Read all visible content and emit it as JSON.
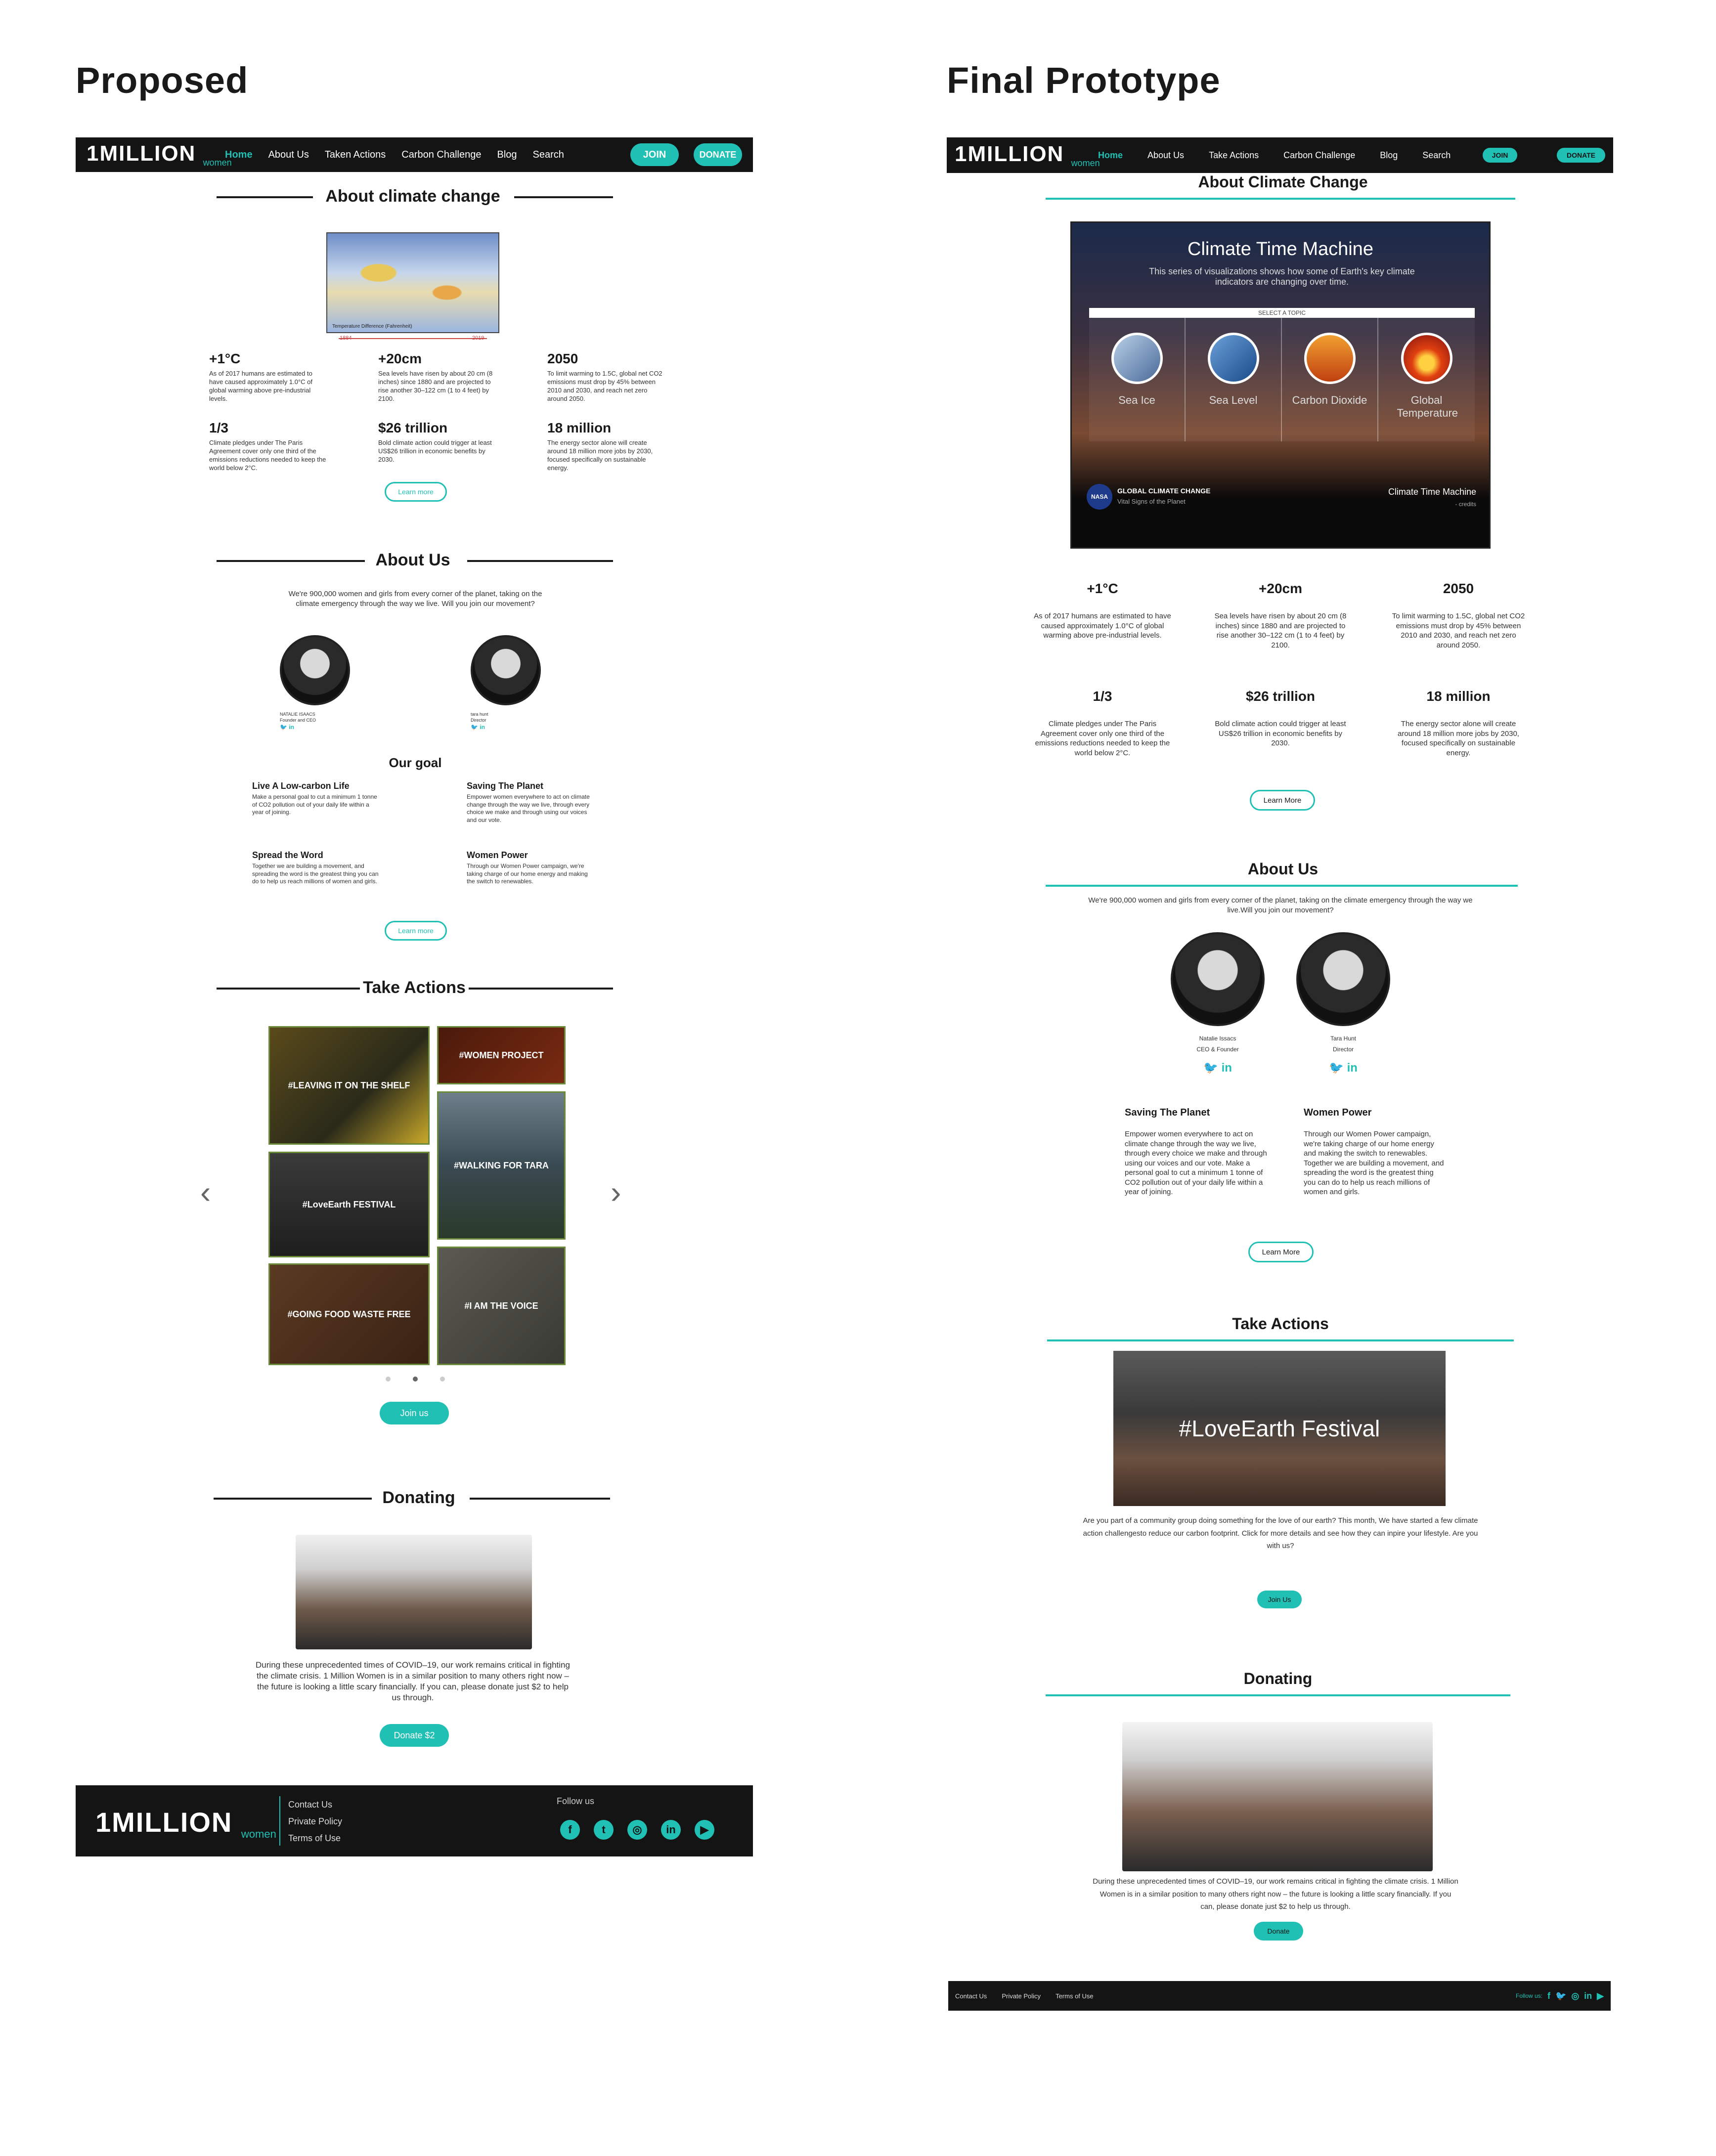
{
  "labels": {
    "proposed": "Proposed",
    "final": "Final Prototype"
  },
  "brand": {
    "logo_main": "1MILLION",
    "logo_sub": "women"
  },
  "nav_proposed": [
    "Home",
    "About Us",
    "Taken Actions",
    "Carbon Challenge",
    "Blog",
    "Search"
  ],
  "nav_final": [
    "Home",
    "About Us",
    "Take Actions",
    "Carbon Challenge",
    "Blog",
    "Search"
  ],
  "buttons": {
    "join_upper": "JOIN",
    "donate_upper": "DONATE",
    "learn_more": "Learn more",
    "learn_more_final": "Learn More",
    "join_us": "Join us",
    "join_us_final": "Join Us",
    "donate2": "Donate $2",
    "donate": "Donate"
  },
  "proposed": {
    "about_climate_title": "About climate change",
    "map_legend": "Temperature Difference (Fahrenheit)",
    "map_years": [
      "1884",
      "2019"
    ],
    "stats": [
      {
        "n": "+1°C",
        "t": "As of 2017 humans are estimated to have caused approximately 1.0°C of global warming above pre-industrial levels."
      },
      {
        "n": "+20cm",
        "t": "Sea levels have risen by about 20 cm (8 inches) since 1880 and are projected to rise another 30–122 cm (1 to 4 feet) by 2100."
      },
      {
        "n": "2050",
        "t": "To limit warming to 1.5C, global net CO2 emissions must drop by 45% between 2010 and 2030, and reach net zero around 2050."
      },
      {
        "n": "1/3",
        "t": "Climate pledges under The Paris Agreement cover only one third of the emissions reductions needed to keep the world below 2°C."
      },
      {
        "n": "$26 trillion",
        "t": "Bold climate action could trigger at least US$26 trillion in economic benefits by 2030."
      },
      {
        "n": "18 million",
        "t": "The energy sector alone will create around 18 million more jobs by 2030, focused specifically on sustainable energy."
      }
    ],
    "about_us_title": "About Us",
    "about_us_text": "We're 900,000 women and girls from every corner of the planet, taking on the climate emergency through the way we live. Will you join our movement?",
    "people": [
      {
        "name": "NATALIE ISAACS",
        "role": "Founder and CEO"
      },
      {
        "name": "tara hunt",
        "role": "Director"
      }
    ],
    "goal_title": "Our goal",
    "goals": [
      {
        "h": "Live A Low-carbon Life",
        "t": "Make a personal goal to cut a minimum 1 tonne of CO2 pollution out of your daily life within a year of joining."
      },
      {
        "h": "Saving The Planet",
        "t": "Empower women everywhere to act on climate change through the way we live, through every choice we make and through using our voices and our vote."
      },
      {
        "h": "Spread the Word",
        "t": "Together we are building a movement, and spreading the word is the greatest thing you can do to help us reach millions of women and girls."
      },
      {
        "h": "Women Power",
        "t": "Through our Women Power campaign, we're taking charge of our home energy and making the switch to renewables."
      }
    ],
    "take_actions_title": "Take Actions",
    "tiles": [
      "#LEAVING IT ON THE SHELF",
      "#WOMEN PROJECT",
      "#WALKING FOR TARA",
      "#LoveEarth FESTIVAL",
      "#GOING FOOD WASTE FREE",
      "#I AM THE VOICE"
    ],
    "donating_title": "Donating",
    "donating_text": "During these unprecedented times of COVID–19, our work remains critical in fighting the climate crisis. 1 Million Women is in a similar position to many others right now – the future is looking a little scary financially. If you can, please donate just $2 to help us through.",
    "footer_links": [
      "Contact Us",
      "Private Policy",
      "Terms of Use"
    ],
    "follow_us": "Follow us"
  },
  "final": {
    "about_climate_title": "About Climate Change",
    "ctm_title": "Climate Time Machine",
    "ctm_sub": "This series of visualizations shows how some of Earth's key climate indicators are changing over time.",
    "ctm_select": "SELECT A TOPIC",
    "ctm_topics": [
      "Sea Ice",
      "Sea Level",
      "Carbon Dioxide",
      "Global Temperature"
    ],
    "ctm_brand": "GLOBAL CLIMATE CHANGE",
    "ctm_brand_sub": "Vital Signs of the Planet",
    "ctm_nasa": "NASA",
    "ctm_credit_title": "Climate Time Machine",
    "ctm_credit": "- credits",
    "stats": [
      {
        "n": "+1°C",
        "t": "As of 2017 humans are estimated to have caused approximately 1.0°C of global warming above pre-industrial levels."
      },
      {
        "n": "+20cm",
        "t": "Sea levels have risen by about 20 cm (8 inches) since 1880 and are projected to rise another 30–122 cm (1 to 4 feet) by 2100."
      },
      {
        "n": "2050",
        "t": "To limit warming to 1.5C, global net CO2 emissions must drop by 45% between 2010 and 2030, and reach net zero around 2050."
      },
      {
        "n": "1/3",
        "t": "Climate pledges under The Paris Agreement cover only one third of the emissions reductions needed to keep the world below 2°C."
      },
      {
        "n": "$26 trillion",
        "t": "Bold climate action could trigger at least US$26 trillion in economic benefits by 2030."
      },
      {
        "n": "18 million",
        "t": "The energy sector alone will create around 18 million more jobs by 2030, focused specifically on sustainable energy."
      }
    ],
    "about_us_title": "About Us",
    "about_us_text": "We're 900,000 women and girls from every corner of the planet, taking on the climate emergency through the way we live.Will you join our movement?",
    "people": [
      {
        "name": "Natalie Issacs",
        "role": "CEO & Founder"
      },
      {
        "name": "Tara Hunt",
        "role": "Director"
      }
    ],
    "goals": [
      {
        "h": "Saving The Planet",
        "t": "Empower women everywhere to act on climate change through the way we live, through every choice we make and through using our voices and our vote. Make a personal goal to cut a minimum 1 tonne of CO2 pollution out of your daily life within a year of joining."
      },
      {
        "h": "Women Power",
        "t": "Through our Women Power campaign, we're taking charge of our home energy and making the switch to renewables. Together we are building a movement, and spreading the word is the greatest thing you can do to help us reach millions of women and girls."
      }
    ],
    "take_actions_title": "Take Actions",
    "festival": "#LoveEarth Festival",
    "take_actions_text": "Are you part of a community group doing something for the love of our earth? This month, We have started a few climate action challengesto reduce our carbon footprint. Click for more details and see how they can inpire your lifestyle. Are you with us?",
    "donating_title": "Donating",
    "donating_text": "During these unprecedented times of COVID–19, our work remains critical in fighting the climate crisis. 1 Million Women is in a similar position to many others right now – the future is looking a little scary financially. If you can, please donate just $2 to help us through.",
    "footer_links": [
      "Contact Us",
      "Private Policy",
      "Terms of Use"
    ],
    "follow_us": "Follow us:"
  },
  "colors": {
    "accent": "#20c0b4",
    "nav_bg": "#141414"
  },
  "icons": {
    "carousel_prev": "chevron-left-icon",
    "carousel_next": "chevron-right-icon",
    "social": [
      "facebook-icon",
      "twitter-icon",
      "instagram-icon",
      "linkedin-icon",
      "youtube-icon"
    ]
  }
}
